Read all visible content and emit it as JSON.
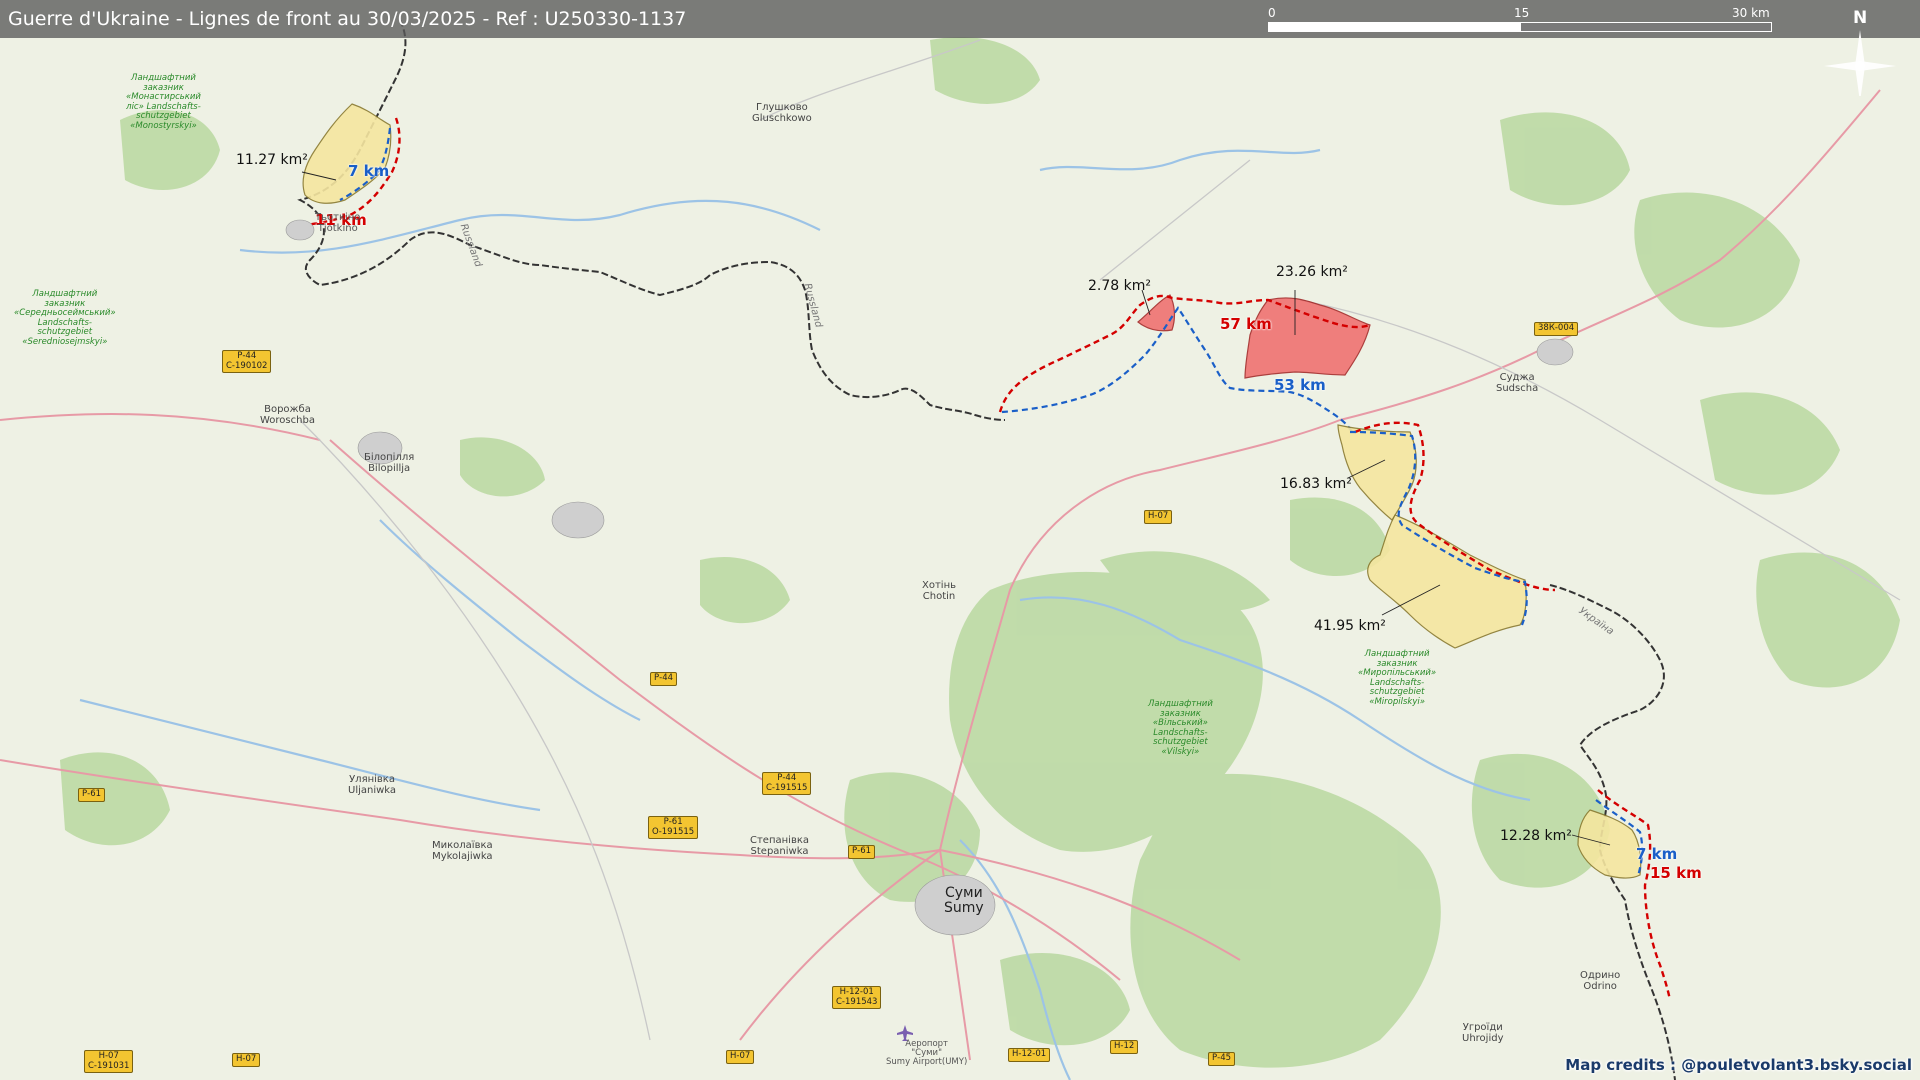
{
  "title": "Guerre d'Ukraine - Lignes de front au 30/03/2025 - Ref : U250330-1137",
  "scale_bar": {
    "ticks": [
      "0",
      "15",
      "30 km"
    ]
  },
  "compass": {
    "label": "N",
    "icon": "compass-rose-icon"
  },
  "colors": {
    "gain_ukraine": "#f06a6a",
    "gain_russia": "#f5e6a0",
    "front_red": "#d40000",
    "front_blue": "#1a5fc8",
    "border": "#333333"
  },
  "zones": [
    {
      "id": "zone-nw",
      "area": "11.27 km²",
      "red_len": "11 km",
      "blue_len": "7 km",
      "color": "yellow"
    },
    {
      "id": "zone-small-red",
      "area": "2.78 km²",
      "color": "red"
    },
    {
      "id": "zone-big-red",
      "area": "23.26 km²",
      "red_len": "57 km",
      "blue_len": "53 km",
      "color": "red"
    },
    {
      "id": "zone-mid-yellow",
      "area": "16.83 km²",
      "color": "yellow"
    },
    {
      "id": "zone-large-yellow",
      "area": "41.95 km²",
      "color": "yellow"
    },
    {
      "id": "zone-se",
      "area": "12.28 km²",
      "red_len": "15 km",
      "blue_len": "7 km",
      "color": "yellow"
    }
  ],
  "towns": {
    "gluschkowo": "Глушково\nGluschkowo",
    "tjotkino": "Тьоткіно\nTjotkino",
    "russland_a": "Russland",
    "russland_b": "Russland",
    "woroschba": "Ворожба\nWoroschba",
    "bilopillja": "Білопілля\nBilopillja",
    "sudscha": "Суджа\nSudscha",
    "chotin": "Хотінь\nChotin",
    "uljaniwka": "Улянівка\nUljaniwka",
    "mykolajiwka": "Миколаївка\nMykolajiwka",
    "stepaniwka": "Степанівка\nStepaniwka",
    "sumy": "Суми\nSumy",
    "uhrojidy": "Угроїди\nUhrojidy",
    "odrino": "Одрино\nOdrino",
    "airport": "Аеропорт\n\"Суми\"\nSumy Airport(UMY)",
    "ukraina": "Україна"
  },
  "nature_reserves": {
    "monostyrskyi": "Ландшафтний\nзаказник\n«Монастирський\nліс» Landschafts-\nschutzgebiet\n«Monostyrskyi»",
    "seredniansky": "Ландшафтний\nзаказник\n«Середньосеймський»\nLandschafts-\nschutzgebiet\n«Seredniosejmskyi»",
    "myropilskyi": "Ландшафтний\nзаказник\n«Миропільський»\nLandschafts-\nschutzgebiet\n«Miropilskyi»",
    "vilskyi": "Ландшафтний\nзаказник\n«Вільський»\nLandschafts-\nschutzgebiet\n«Vilskyi»"
  },
  "road_shields": [
    {
      "id": "p44-a",
      "text": "Р-44\nС-190102"
    },
    {
      "id": "p44-b",
      "text": "Р-44"
    },
    {
      "id": "p44-c",
      "text": "Р-44\nС-191515"
    },
    {
      "id": "p61-a",
      "text": "Р-61"
    },
    {
      "id": "p61-b",
      "text": "Р-61\nО-191515"
    },
    {
      "id": "p61-c",
      "text": "Р-61"
    },
    {
      "id": "h07-a",
      "text": "Н-07"
    },
    {
      "id": "h07-b",
      "text": "Н-07\nС-191031"
    },
    {
      "id": "h07-c",
      "text": "Н-07"
    },
    {
      "id": "h07-d",
      "text": "Н-07"
    },
    {
      "id": "h1201-a",
      "text": "Н-12-01\nС-191543"
    },
    {
      "id": "h1201-b",
      "text": "Н-12-01"
    },
    {
      "id": "h12",
      "text": "Н-12"
    },
    {
      "id": "p45",
      "text": "Р-45"
    },
    {
      "id": "38k004",
      "text": "38К-004"
    }
  ],
  "credits": "Map credits : @pouletvolant3.bsky.social"
}
